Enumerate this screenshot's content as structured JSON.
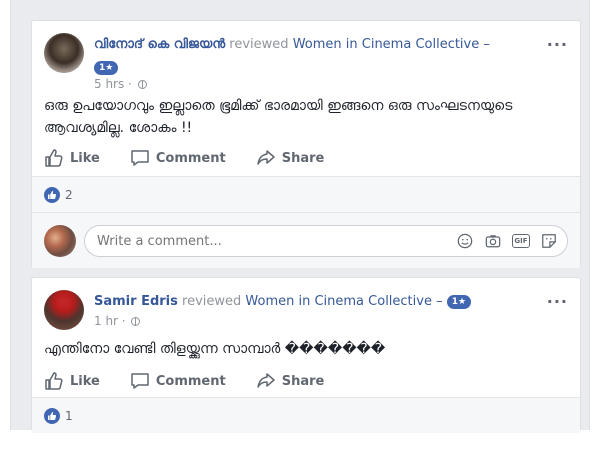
{
  "colors": {
    "link": "#365899",
    "muted": "#90949c",
    "accent": "#4267b2",
    "background": "#e9ebee"
  },
  "posts": [
    {
      "author": "വിനോദ് കെ വിജയൻ",
      "verb": "reviewed",
      "page": "Women in Cinema Collective",
      "dash": "–",
      "rating": "1★",
      "time": "5 hrs ·",
      "text": "ഒരു ഉപയോഗവും ഇല്ലാതെ ഭൂമിക്ക് ഭാരമായി ഇങ്ങനെ ഒരു സംഘടനയുടെ ആവശ്യമില്ല. ശോകം !!",
      "like_label": "Like",
      "comment_label": "Comment",
      "share_label": "Share",
      "like_count": "2",
      "more": "···"
    },
    {
      "author": "Samir Edris",
      "verb": "reviewed",
      "page": "Women in Cinema Collective",
      "dash": "–",
      "rating": "1★",
      "time": "1 hr ·",
      "text": "എന്തിനോ വേണ്ടി തിളയ്ക്കുന്ന സാമ്പാർ �������",
      "like_label": "Like",
      "comment_label": "Comment",
      "share_label": "Share",
      "like_count": "1",
      "more": "···"
    }
  ],
  "comment_box": {
    "placeholder": "Write a comment...",
    "gif_label": "GIF"
  },
  "icons": [
    "like-icon",
    "comment-icon",
    "share-icon",
    "globe-icon",
    "emoji-icon",
    "camera-icon",
    "gif-icon",
    "sticker-icon",
    "more-options-icon"
  ]
}
